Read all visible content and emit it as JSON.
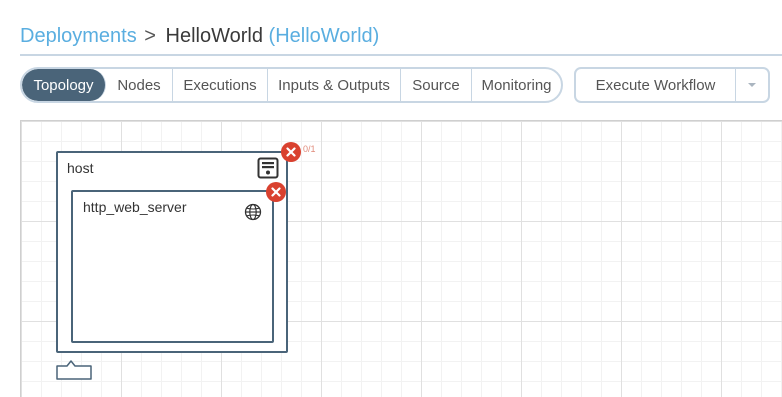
{
  "breadcrumb": {
    "root": "Deployments",
    "separator": ">",
    "current": "HelloWorld",
    "blueprint": "(HelloWorld)"
  },
  "tabs": [
    {
      "label": "Topology",
      "active": true
    },
    {
      "label": "Nodes",
      "active": false
    },
    {
      "label": "Executions",
      "active": false
    },
    {
      "label": "Inputs & Outputs",
      "active": false
    },
    {
      "label": "Source",
      "active": false
    },
    {
      "label": "Monitoring",
      "active": false
    }
  ],
  "execute": {
    "label": "Execute Workflow",
    "dropdown_icon": "caret-down-icon"
  },
  "topology": {
    "host": {
      "name": "host",
      "icon": "server-icon",
      "status_icon": "error-icon",
      "instances": "0/1"
    },
    "web_server": {
      "name": "http_web_server",
      "icon": "globe-icon",
      "status_icon": "error-icon"
    }
  },
  "colors": {
    "accent": "#5aaee0",
    "tab_active": "#4a6479",
    "border": "#c8d6e3",
    "error": "#d9412f"
  }
}
